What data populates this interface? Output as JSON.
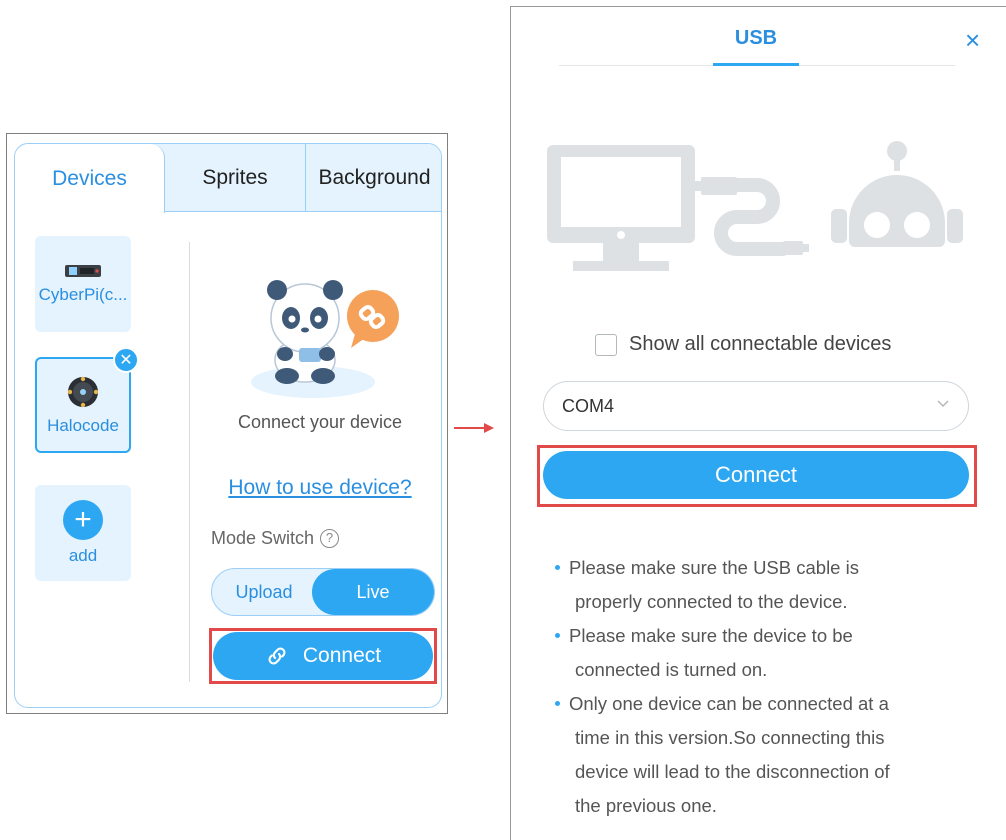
{
  "left_panel": {
    "tabs": [
      {
        "label": "Devices"
      },
      {
        "label": "Sprites"
      },
      {
        "label": "Background"
      }
    ],
    "devices": [
      {
        "label": "CyberPi(c..."
      },
      {
        "label": "Halocode"
      }
    ],
    "add_label": "add",
    "remove_glyph": "✕",
    "connect_text": "Connect your device",
    "howto_link": "How to use device?",
    "mode_switch_label": "Mode Switch",
    "help_glyph": "?",
    "mode_upload": "Upload",
    "mode_live": "Live",
    "connect_button": "Connect"
  },
  "right_panel": {
    "tab_label": "USB",
    "close_glyph": "×",
    "show_all_label": "Show all connectable devices",
    "port_value": "COM4",
    "connect_button": "Connect",
    "tips": [
      {
        "line1": "Please make sure the USB cable is",
        "line2": "properly connected to the device."
      },
      {
        "line1": "Please make sure the device to be",
        "line2": "connected is turned on."
      },
      {
        "line1": "Only one device can be connected at a",
        "line2": "time in this version.So connecting this",
        "line3": "device will lead to the disconnection of",
        "line4": "the previous one."
      }
    ]
  },
  "colors": {
    "accent": "#2ea7f2",
    "accent_text": "#2a8fe0",
    "highlight_frame": "#e24a4a",
    "tab_bg": "#e4f3fd",
    "illustration_gray": "#dde1e4"
  },
  "icons": [
    "link-icon",
    "plus-icon",
    "close-icon",
    "help-icon",
    "chevron-down-icon",
    "arrow-right-icon",
    "computer-icon",
    "usb-cable-icon",
    "robot-icon",
    "panda-illustration"
  ]
}
